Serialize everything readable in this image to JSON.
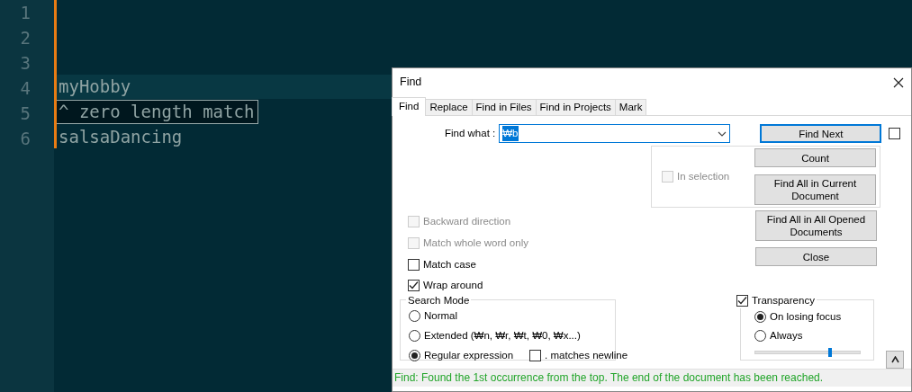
{
  "editor": {
    "lines": [
      {
        "number": "1",
        "current": false
      },
      {
        "number": "2",
        "current": false
      },
      {
        "number": "3",
        "current": false
      },
      {
        "number": "4",
        "kind": "code",
        "text": "myHobby",
        "current": true
      },
      {
        "number": "5",
        "kind": "annotation",
        "text": "^ zero length match",
        "current": false
      },
      {
        "number": "6",
        "kind": "code",
        "text": "salsaDancing",
        "current": false
      }
    ]
  },
  "dialog": {
    "title": "Find",
    "tabs": [
      {
        "label": "Find",
        "selected": true
      },
      {
        "label": "Replace",
        "selected": false
      },
      {
        "label": "Find in Files",
        "selected": false
      },
      {
        "label": "Find in Projects",
        "selected": false
      },
      {
        "label": "Mark",
        "selected": false
      }
    ],
    "find_what": {
      "label": "Find what :",
      "value": "₩b",
      "value_selected": true
    },
    "find_next": {
      "label": "Find Next",
      "default": true
    },
    "side_checkbox": {
      "checked": false
    },
    "in_selection": {
      "label": "In selection",
      "checked": false,
      "disabled": true
    },
    "group_buttons": [
      {
        "label": "Count"
      },
      {
        "label": "Find All in Current Document"
      }
    ],
    "buttons": [
      {
        "label": "Find All in All Opened Documents"
      },
      {
        "label": "Close"
      }
    ],
    "options": [
      {
        "label": "Backward direction",
        "checked": false,
        "disabled": true
      },
      {
        "label": "Match whole word only",
        "checked": false,
        "disabled": true
      },
      {
        "label": "Match case",
        "checked": false,
        "disabled": false
      },
      {
        "label": "Wrap around",
        "checked": true,
        "disabled": false
      }
    ],
    "search_mode": {
      "title": "Search Mode",
      "options": [
        {
          "label": "Normal",
          "selected": false
        },
        {
          "label": "Extended (₩n, ₩r, ₩t, ₩0, ₩x...)",
          "selected": false
        },
        {
          "label": "Regular expression",
          "selected": true
        }
      ],
      "dot_newline": {
        "label": ". matches newline",
        "checked": false
      }
    },
    "transparency": {
      "label": "Transparency",
      "checked": true,
      "options": [
        {
          "label": "On losing focus",
          "selected": true
        },
        {
          "label": "Always",
          "selected": false
        }
      ],
      "level": 0.7
    },
    "status": "Find: Found the 1st occurrence from the top. The end of the document has been reached."
  }
}
